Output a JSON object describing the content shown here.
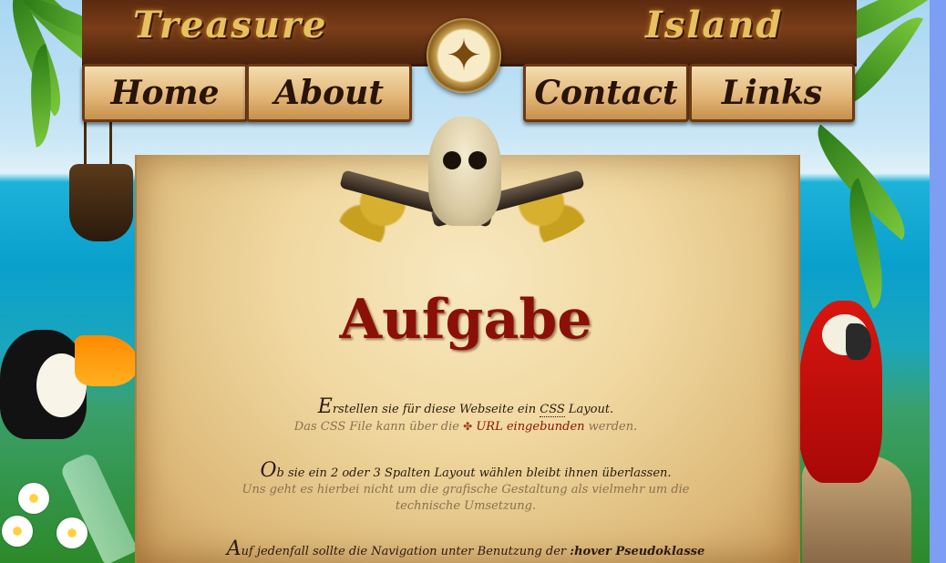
{
  "header": {
    "title_left": "Treasure",
    "title_right": "Island",
    "compass_icon": "compass-rose-icon"
  },
  "nav": {
    "items": [
      {
        "label": "Home"
      },
      {
        "label": "About"
      },
      {
        "label": "Contact"
      },
      {
        "label": "Links"
      }
    ]
  },
  "main": {
    "title": "Aufgabe",
    "paragraphs": [
      {
        "initial": "E",
        "line1_a": "rstellen sie für diese Webseite ein ",
        "line1_abbr": "CSS",
        "line1_b": " Layout.",
        "sub_a": "Das CSS File kann über die ",
        "sub_link": "URL eingebunden",
        "sub_b": " werden."
      },
      {
        "initial": "O",
        "line1": "b sie ein 2 oder 3 Spalten Layout wählen bleibt ihnen überlassen.",
        "sub": "Uns geht es hierbei nicht um die grafische Gestaltung als vielmehr um die technische Umsetzung."
      },
      {
        "initial": "A",
        "line1_a": "uf jedenfall sollte die Navigation unter Benutzung der ",
        "line1_bold": ":hover Pseudoklasse"
      }
    ]
  },
  "colors": {
    "title": "#8a1008",
    "sky": "#a8d6f2",
    "sea": "#1db2d8",
    "parchment": "#f0d8a0"
  }
}
